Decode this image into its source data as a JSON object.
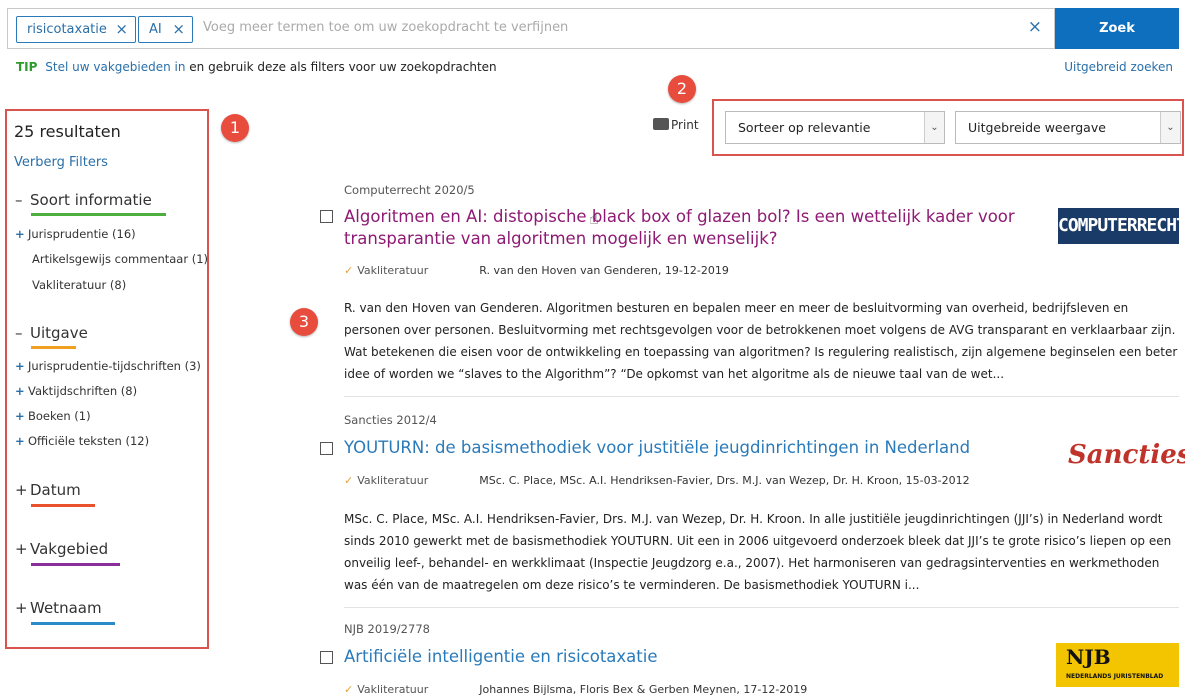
{
  "search": {
    "chips": [
      {
        "label": "risicotaxatie"
      },
      {
        "label": "AI"
      }
    ],
    "placeholder": "Voeg meer termen toe om uw zoekopdracht te verfijnen",
    "clear_icon": "×",
    "button_label": "Zoek"
  },
  "tip": {
    "tag": "TIP",
    "link": "Stel uw vakgebieden in",
    "text": "en gebruik deze als filters voor uw zoekopdrachten",
    "advanced_link": "Uitgebreid zoeken"
  },
  "filters": {
    "result_count": "25 resultaten",
    "hide_label": "Verberg Filters",
    "facets": [
      {
        "title": "Soort informatie",
        "symbol": "–",
        "color": "#4caf3e",
        "items": [
          {
            "label": "Jurisprudentie",
            "count": "(16)",
            "expandable": true
          },
          {
            "label": "Artikelsgewijs commentaar",
            "count": "(1)",
            "expandable": false
          },
          {
            "label": "Vakliteratuur",
            "count": "(8)",
            "expandable": false
          }
        ]
      },
      {
        "title": "Uitgave",
        "symbol": "–",
        "color": "#f0a020",
        "items": [
          {
            "label": "Jurisprudentie-tijdschriften",
            "count": "(3)",
            "expandable": true
          },
          {
            "label": "Vaktijdschriften",
            "count": "(8)",
            "expandable": true
          },
          {
            "label": "Boeken",
            "count": "(1)",
            "expandable": true
          },
          {
            "label": "Officiële teksten",
            "count": "(12)",
            "expandable": true
          }
        ]
      },
      {
        "title": "Datum",
        "symbol": "+",
        "color": "#e8532c",
        "items": []
      },
      {
        "title": "Vakgebied",
        "symbol": "+",
        "color": "#8a2f9a",
        "items": []
      },
      {
        "title": "Wetnaam",
        "symbol": "+",
        "color": "#2a8bc8",
        "items": []
      }
    ]
  },
  "badges": [
    "1",
    "2",
    "3"
  ],
  "toolbar": {
    "print_label": "Print",
    "sort_value": "Sorteer op relevantie",
    "view_value": "Uitgebreide weergave",
    "dropdown_arrow": "⌄"
  },
  "results": [
    {
      "source": "Computerrecht 2020/5",
      "title_line1": "Algoritmen en AI: distopische black box of glazen bol? Is een wettelijk kader voor",
      "title_line2": "transparantie van algoritmen mogelijk en wenselijk?",
      "type": "Vakliteratuur",
      "authors": "R. van den Hoven van Genderen, 19-12-2019",
      "snippet": "R. van den Hoven van Genderen. Algoritmen besturen en bepalen meer en meer de besluitvorming van overheid, bedrijfsleven en personen over personen. Besluitvorming met rechtsgevolgen voor de betrokkenen moet volgens de AVG transparant en verklaarbaar zijn. Wat betekenen die eisen voor de ontwikkeling en toepassing van algoritmen? Is regulering realistisch, zijn algemene beginselen een beter idee of worden we “slaves to the Algorithm”? “De opkomst van het algoritme als de nieuwe taal van de wet...",
      "logo": "COMPUTERRECHT"
    },
    {
      "source": "Sancties 2012/4",
      "title_line1": "YOUTURN: de basismethodiek voor justitiële jeugdinrichtingen in Nederland",
      "type": "Vakliteratuur",
      "authors": "MSc. C. Place, MSc. A.I. Hendriksen-Favier, Drs. M.J. van Wezep, Dr. H. Kroon, 15-03-2012",
      "snippet": "MSc. C. Place, MSc. A.I. Hendriksen-Favier, Drs. M.J. van Wezep, Dr. H. Kroon. In alle justitiële jeugdinrichtingen (JJI’s) in Nederland wordt sinds 2010 gewerkt met de basismethodiek YOUTURN. Uit een in 2006 uitgevoerd onderzoek bleek dat JJI’s te grote risico’s liepen op een onveilig leef-, behandel- en werkklimaat (Inspectie Jeugdzorg e.a., 2007). Het harmoniseren van gedragsinterventies en werkmethoden was één van de maatregelen om deze risico’s te verminderen. De basismethodiek YOUTURN i...",
      "logo": "Sancties"
    },
    {
      "source": "NJB 2019/2778",
      "title_line1": "Artificiële intelligentie en risicotaxatie",
      "type": "Vakliteratuur",
      "authors": "Johannes Bijlsma, Floris Bex & Gerben Meynen, 17-12-2019",
      "logo": "NJB",
      "logo_sub": "NEDERLANDS JURISTENBLAD"
    }
  ]
}
